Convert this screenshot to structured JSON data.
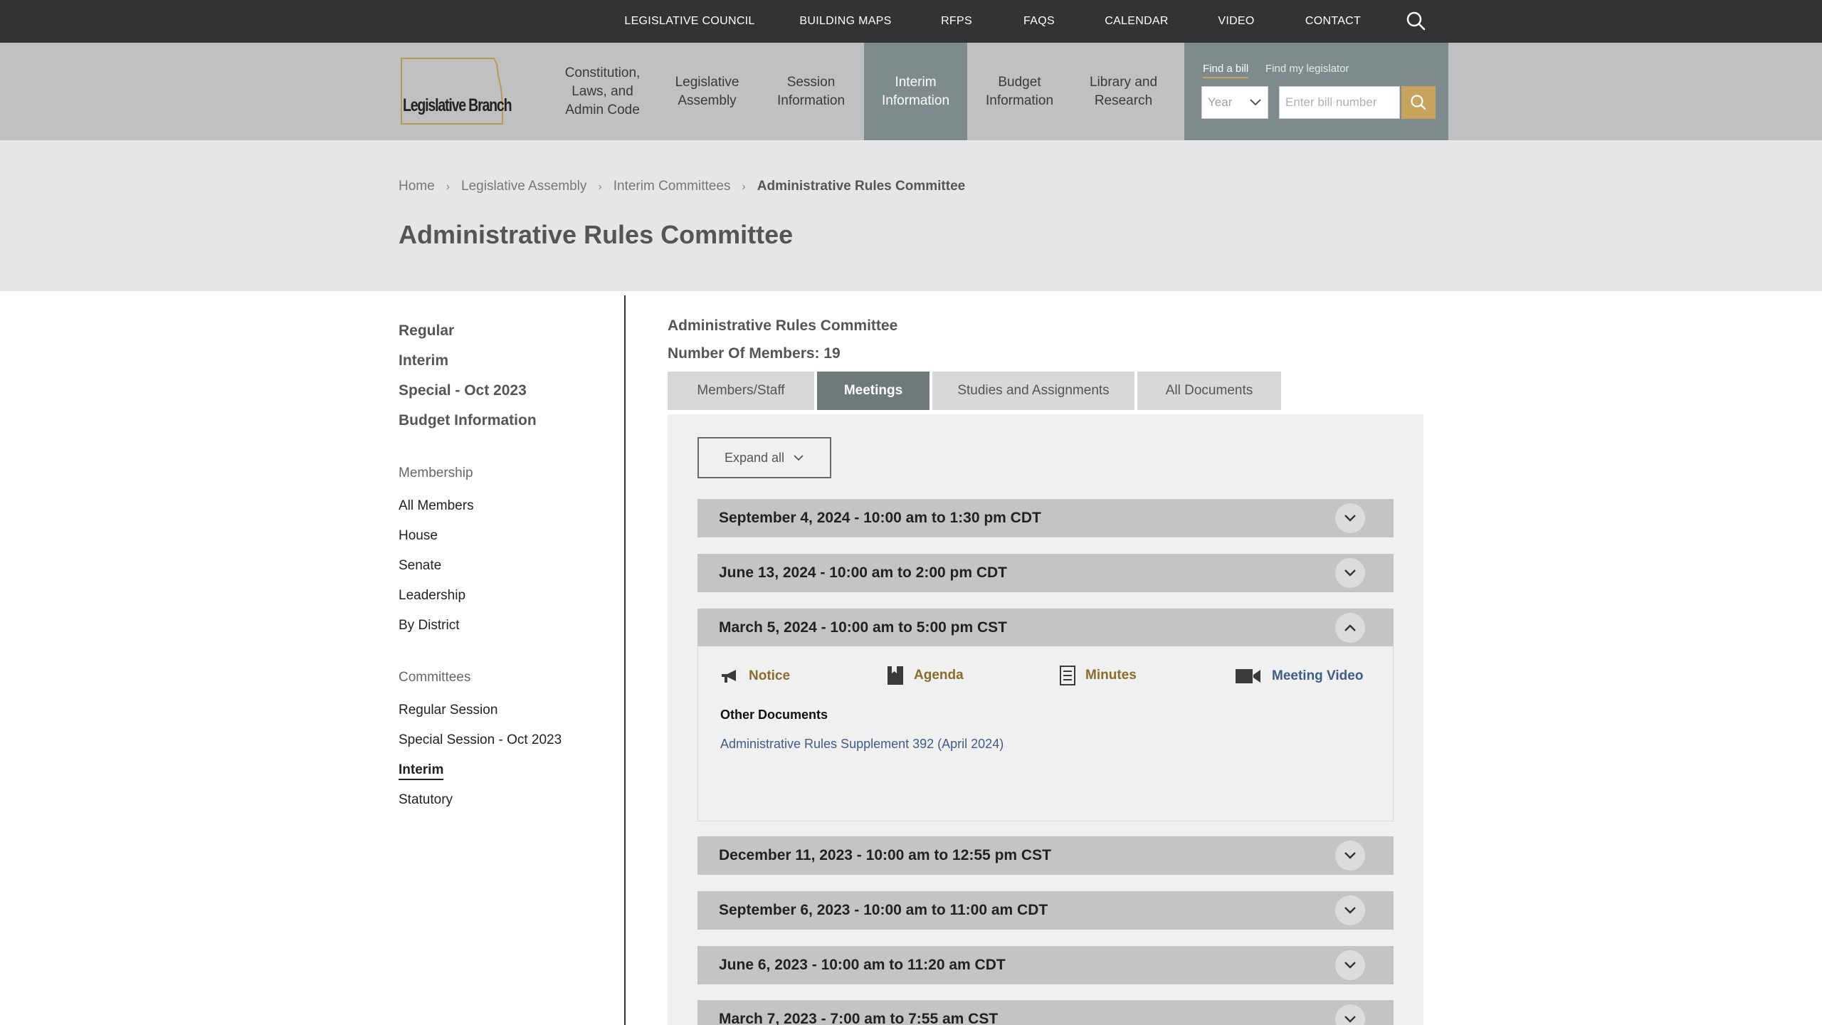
{
  "topbar": {
    "links": [
      "LEGISLATIVE COUNCIL",
      "BUILDING MAPS",
      "RFPS",
      "FAQS",
      "CALENDAR",
      "VIDEO",
      "CONTACT"
    ]
  },
  "header": {
    "logo_text": "Legislative Branch",
    "nav": [
      "Constitution, Laws, and Admin Code",
      "Legislative Assembly",
      "Session Information",
      "Interim Information",
      "Budget Information",
      "Library and Research"
    ],
    "active_nav": "Interim Information",
    "find": {
      "tab_bill": "Find a bill",
      "tab_legislator": "Find my legislator",
      "year_label": "Year",
      "bill_placeholder": "Enter bill number"
    }
  },
  "breadcrumb": {
    "items": [
      "Home",
      "Legislative Assembly",
      "Interim Committees"
    ],
    "current": "Administrative Rules Committee",
    "separator": "›"
  },
  "page_title": "Administrative Rules Committee",
  "sidebar": {
    "major": [
      "Regular",
      "Interim",
      "Special - Oct 2023",
      "Budget Information"
    ],
    "membership_heading": "Membership",
    "membership": [
      "All Members",
      "House",
      "Senate",
      "Leadership",
      "By District"
    ],
    "committees_heading": "Committees",
    "committees": [
      "Regular Session",
      "Special Session - Oct 2023",
      "Interim",
      "Statutory"
    ],
    "current_committee": "Interim"
  },
  "committee": {
    "name": "Administrative Rules Committee",
    "members": "Number Of Members: 19"
  },
  "tabs": [
    "Members/Staff",
    "Meetings",
    "Studies and Assignments",
    "All Documents"
  ],
  "active_tab": "Meetings",
  "expand_all": "Expand all",
  "meetings": [
    "September 4, 2024 - 10:00 am to 1:30 pm CDT",
    "June 13, 2024 - 10:00 am to 2:00 pm CDT",
    "March 5, 2024 - 10:00 am to 5:00 pm CST",
    "December 11, 2023 - 10:00 am to 12:55 pm CST",
    "September 6, 2023 - 10:00 am to 11:00 am CDT",
    "June 6, 2023 - 10:00 am to 11:20 am CDT",
    "March 7, 2023 - 7:00 am to 7:55 am CST"
  ],
  "expanded_meeting": {
    "docs": [
      "Notice",
      "Agenda",
      "Minutes",
      "Meeting Video"
    ],
    "other_heading": "Other Documents",
    "other_docs": [
      "Administrative Rules Supplement 392 (April 2024)"
    ]
  },
  "colors": {
    "topbar": "#333333",
    "header": "#c0c0c0",
    "accent_nav": "#7e8a8b",
    "gold": "#c8a35e",
    "link_gold": "#8a6d2c",
    "link_blue": "#3f5d86"
  }
}
